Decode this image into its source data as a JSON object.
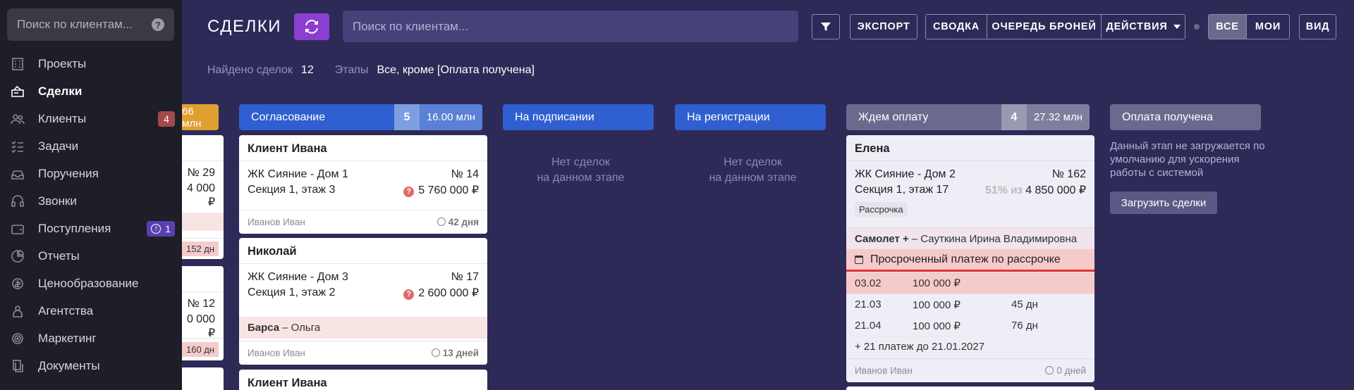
{
  "sidebar": {
    "search_placeholder": "Поиск по клиентам...",
    "items": [
      {
        "label": "Проекты",
        "icon": "building-icon"
      },
      {
        "label": "Сделки",
        "icon": "deals-icon",
        "active": true
      },
      {
        "label": "Клиенты",
        "icon": "users-icon",
        "badge": "4"
      },
      {
        "label": "Задачи",
        "icon": "tasks-icon"
      },
      {
        "label": "Поручения",
        "icon": "inbox-icon"
      },
      {
        "label": "Звонки",
        "icon": "headset-icon"
      },
      {
        "label": "Поступления",
        "icon": "wallet-icon",
        "badge": "1"
      },
      {
        "label": "Отчеты",
        "icon": "pie-chart-icon"
      },
      {
        "label": "Ценообразование",
        "icon": "pricing-icon"
      },
      {
        "label": "Агентства",
        "icon": "agency-icon"
      },
      {
        "label": "Маркетинг",
        "icon": "target-icon"
      },
      {
        "label": "Документы",
        "icon": "documents-icon"
      }
    ]
  },
  "header": {
    "title": "СДЕЛКИ",
    "search_placeholder": "Поиск по клиентам...",
    "export_label": "ЭКСПОРТ",
    "summary_label": "СВОДКА",
    "queue_label": "ОЧЕРЕДЬ БРОНЕЙ",
    "actions_label": "ДЕЙСТВИЯ",
    "all_label": "ВСЕ",
    "mine_label": "МОИ",
    "view_label": "ВИД"
  },
  "info": {
    "found_label": "Найдено сделок",
    "found_value": "12",
    "stages_label": "Этапы",
    "stages_value": "Все, кроме [Оплата получена]"
  },
  "partial_column": {
    "sum": "66 млн",
    "card1": {
      "num": "№ 29",
      "price": "4 000 ₽",
      "days": "152 дн"
    },
    "card2": {
      "num": "№ 12",
      "price": "0 000 ₽",
      "days": "160 дн"
    }
  },
  "columns": {
    "approval": {
      "name": "Согласование",
      "count": "5",
      "sum": "16.00 млн",
      "cards": [
        {
          "client": "Клиент Ивана",
          "project": "ЖК Сияние - Дом 1",
          "num": "№ 14",
          "section": "Секция 1, этаж 3",
          "price": "5 760 000 ₽",
          "manager": "Иванов Иван",
          "days": "42 дня"
        },
        {
          "client": "Николай",
          "project": "ЖК Сияние - Дом 3",
          "num": "№ 17",
          "section": "Секция 1, этаж 2",
          "price": "2 600 000 ₽",
          "agency": "Барса",
          "agent": "– Ольга",
          "manager": "Иванов Иван",
          "days": "13 дней"
        },
        {
          "client": "Клиент Ивана"
        }
      ]
    },
    "signing": {
      "name": "На подписании",
      "empty_1": "Нет сделок",
      "empty_2": "на данном этапе"
    },
    "registration": {
      "name": "На регистрации",
      "empty_1": "Нет сделок",
      "empty_2": "на данном этапе"
    },
    "waiting": {
      "name": "Ждем оплату",
      "count": "4",
      "sum": "27.32 млн",
      "card": {
        "client": "Елена",
        "project": "ЖК Сияние - Дом 2",
        "num": "№ 162",
        "section": "Секция 1, этаж 17",
        "percent": "51%",
        "of": "из",
        "price": "4 850 000 ₽",
        "tag": "Рассрочка",
        "agency": "Самолет +",
        "agent": "– Сауткина Ирина Владимировна",
        "overdue": "Просроченный платеж по рассрочке",
        "payments": [
          {
            "date": "03.02",
            "amount": "100 000 ₽",
            "days": ""
          },
          {
            "date": "21.03",
            "amount": "100 000 ₽",
            "days": "45 дн"
          },
          {
            "date": "21.04",
            "amount": "100 000 ₽",
            "days": "76 дн"
          }
        ],
        "more": "+ 21 платеж до 21.01.2027",
        "manager": "Иванов Иван",
        "days": "0 дней"
      }
    },
    "received": {
      "name": "Оплата получена",
      "note": "Данный этап не загружается по умолчанию для ускорения работы с системой",
      "load_label": "Загрузить сделки"
    }
  }
}
